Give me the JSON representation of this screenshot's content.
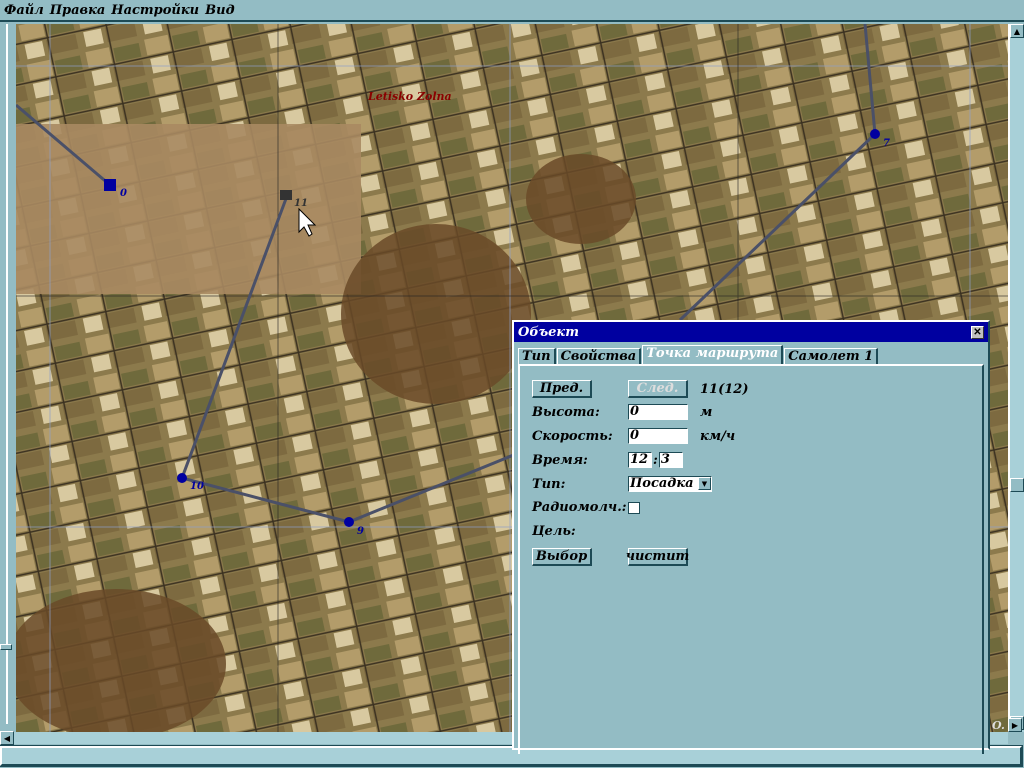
{
  "menu": [
    "Файл",
    "Правка",
    "Настройки",
    "Вид"
  ],
  "map": {
    "airfield_label": "Letisko Zolna",
    "waypoints": [
      {
        "label": "0"
      },
      {
        "label": "11"
      },
      {
        "label": "7"
      },
      {
        "label": "10"
      },
      {
        "label": "9"
      }
    ],
    "corner_text": "O."
  },
  "dialog": {
    "title": "Объект",
    "close": "✕",
    "tabs": [
      "Тип",
      "Свойства",
      "Точка маршрута",
      "Самолет 1"
    ],
    "active_tab": "Точка маршрута",
    "prev": "Пред.",
    "next": "След.",
    "index": "11(12)",
    "altitude_label": "Высота:",
    "altitude": "0",
    "altitude_unit": "м",
    "speed_label": "Скорость:",
    "speed": "0",
    "speed_unit": "км/ч",
    "time_label": "Время:",
    "time_h": "12",
    "time_sep": ":",
    "time_m": "3",
    "type_label": "Тип:",
    "type_value": "Посадка",
    "radio_label": "Радиомолч.:",
    "radio_checked": false,
    "target_label": "Цель:",
    "select": "Выбор",
    "clear": "чистит"
  }
}
